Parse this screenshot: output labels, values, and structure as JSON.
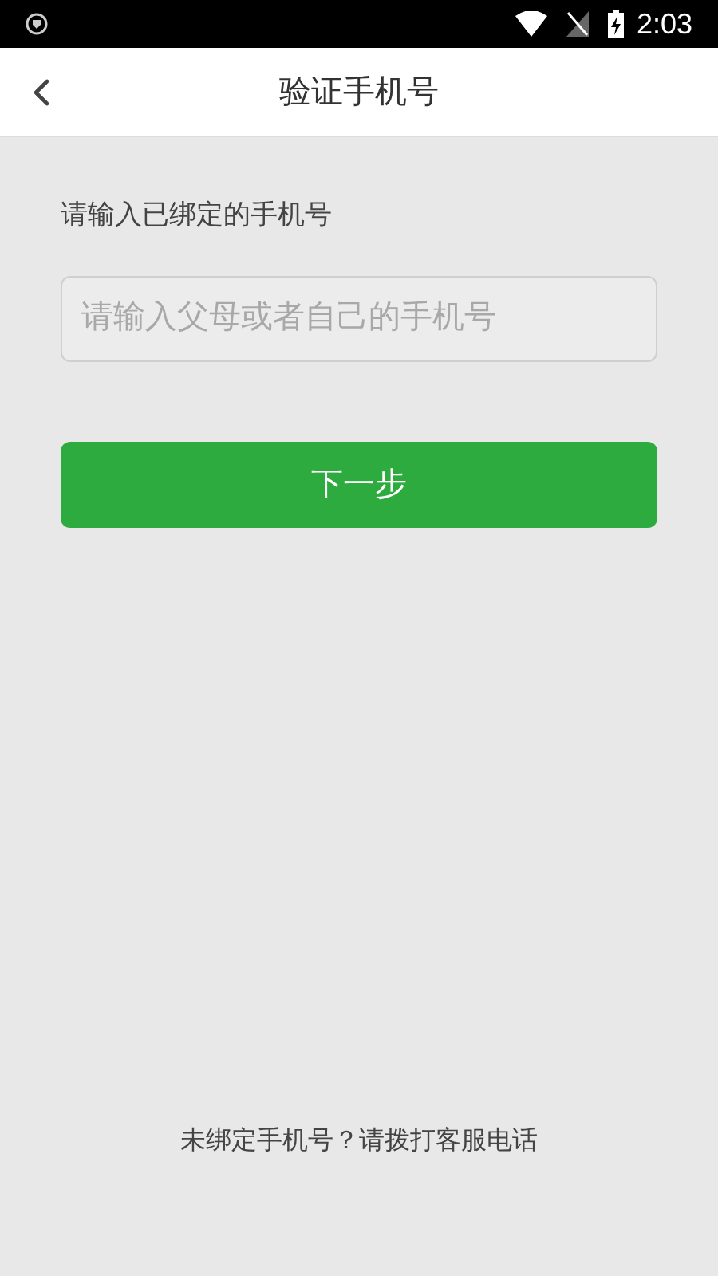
{
  "status_bar": {
    "time": "2:03"
  },
  "header": {
    "title": "验证手机号"
  },
  "form": {
    "label": "请输入已绑定的手机号",
    "phone_field": {
      "placeholder": "请输入父母或者自己的手机号"
    },
    "next_button": "下一步"
  },
  "footer": {
    "hint": "未绑定手机号？请拨打客服电话"
  }
}
